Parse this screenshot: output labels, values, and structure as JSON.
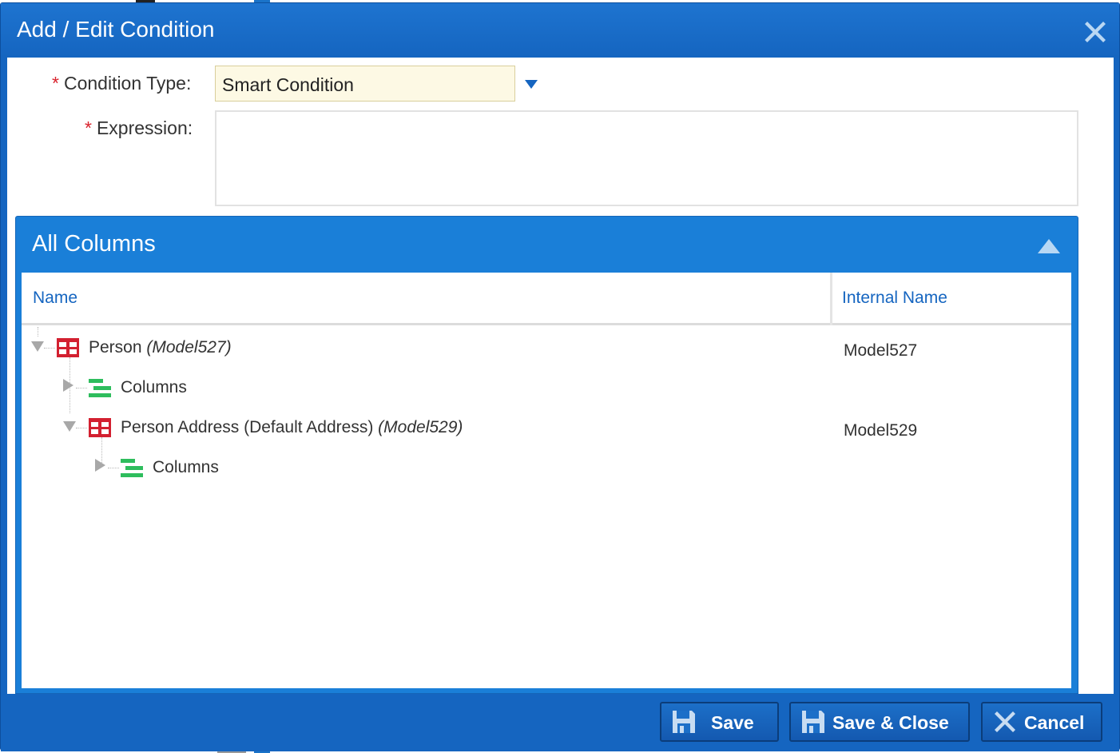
{
  "dialog": {
    "title": "Add / Edit Condition",
    "close_icon": "close-icon"
  },
  "form": {
    "condition_type_label": "Condition Type:",
    "condition_type_value": "Smart Condition",
    "expression_label": "Expression:",
    "expression_value": "",
    "required_marker": "*"
  },
  "panel": {
    "title": "All Columns",
    "columns": {
      "name": "Name",
      "internal_name": "Internal Name"
    },
    "rows": [
      {
        "name": "Person",
        "model": "(Model527)",
        "internal": "Model527",
        "icon": "table-icon",
        "expanded": true
      },
      {
        "name": "Columns",
        "model": "",
        "internal": "",
        "icon": "list-icon",
        "expanded": false
      },
      {
        "name": "Person Address (Default Address)",
        "model": "(Model529)",
        "internal": "Model529",
        "icon": "table-icon",
        "expanded": true
      },
      {
        "name": "Columns",
        "model": "",
        "internal": "",
        "icon": "list-icon",
        "expanded": false
      }
    ]
  },
  "footer": {
    "save_label": "Save",
    "save_close_label": "Save & Close",
    "cancel_label": "Cancel"
  },
  "colors": {
    "primary": "#1565c0",
    "panel_header": "#1a7fd8",
    "required": "#d9232d",
    "table_icon": "#d32030",
    "list_icon": "#2ebd5d",
    "select_bg": "#fdf9e4"
  }
}
